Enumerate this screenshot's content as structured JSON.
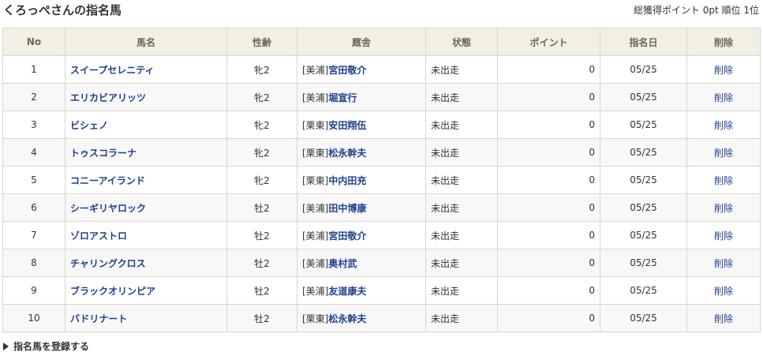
{
  "header": {
    "title": "くろっぺさんの指名馬",
    "summary": "総獲得ポイント 0pt 順位 1位"
  },
  "table": {
    "columns": [
      "No",
      "馬名",
      "性齢",
      "厩舎",
      "状態",
      "ポイント",
      "指名日",
      "削除"
    ],
    "rows": [
      {
        "no": "1",
        "name": "スイープセレニティ",
        "sexage": "牝2",
        "region": "[美浦]",
        "trainer": "宮田敬介",
        "status": "未出走",
        "points": "0",
        "date": "05/25",
        "delete": "削除"
      },
      {
        "no": "2",
        "name": "エリカビアリッツ",
        "sexage": "牝2",
        "region": "[美浦]",
        "trainer": "堀宣行",
        "status": "未出走",
        "points": "0",
        "date": "05/25",
        "delete": "削除"
      },
      {
        "no": "3",
        "name": "ビシェノ",
        "sexage": "牝2",
        "region": "[栗東]",
        "trainer": "安田翔伍",
        "status": "未出走",
        "points": "0",
        "date": "05/25",
        "delete": "削除"
      },
      {
        "no": "4",
        "name": "トゥスコラーナ",
        "sexage": "牝2",
        "region": "[栗東]",
        "trainer": "松永幹夫",
        "status": "未出走",
        "points": "0",
        "date": "05/25",
        "delete": "削除"
      },
      {
        "no": "5",
        "name": "コニーアイランド",
        "sexage": "牝2",
        "region": "[栗東]",
        "trainer": "中内田充",
        "status": "未出走",
        "points": "0",
        "date": "05/25",
        "delete": "削除"
      },
      {
        "no": "6",
        "name": "シーギリヤロック",
        "sexage": "牡2",
        "region": "[美浦]",
        "trainer": "田中博康",
        "status": "未出走",
        "points": "0",
        "date": "05/25",
        "delete": "削除"
      },
      {
        "no": "7",
        "name": "ゾロアストロ",
        "sexage": "牡2",
        "region": "[美浦]",
        "trainer": "宮田敬介",
        "status": "未出走",
        "points": "0",
        "date": "05/25",
        "delete": "削除"
      },
      {
        "no": "8",
        "name": "チャリングクロス",
        "sexage": "牡2",
        "region": "[美浦]",
        "trainer": "奥村武",
        "status": "未出走",
        "points": "0",
        "date": "05/25",
        "delete": "削除"
      },
      {
        "no": "9",
        "name": "ブラックオリンピア",
        "sexage": "牡2",
        "region": "[美浦]",
        "trainer": "友道康夫",
        "status": "未出走",
        "points": "0",
        "date": "05/25",
        "delete": "削除"
      },
      {
        "no": "10",
        "name": "バドリナート",
        "sexage": "牡2",
        "region": "[栗東]",
        "trainer": "松永幹夫",
        "status": "未出走",
        "points": "0",
        "date": "05/25",
        "delete": "削除"
      }
    ]
  },
  "footer": {
    "register_label": "指名馬を登録する",
    "register_icon": "triangle-right-icon"
  },
  "colors": {
    "header_bg": "#f3efe3",
    "link": "#1f3f8f",
    "border": "#d9d6cc"
  }
}
